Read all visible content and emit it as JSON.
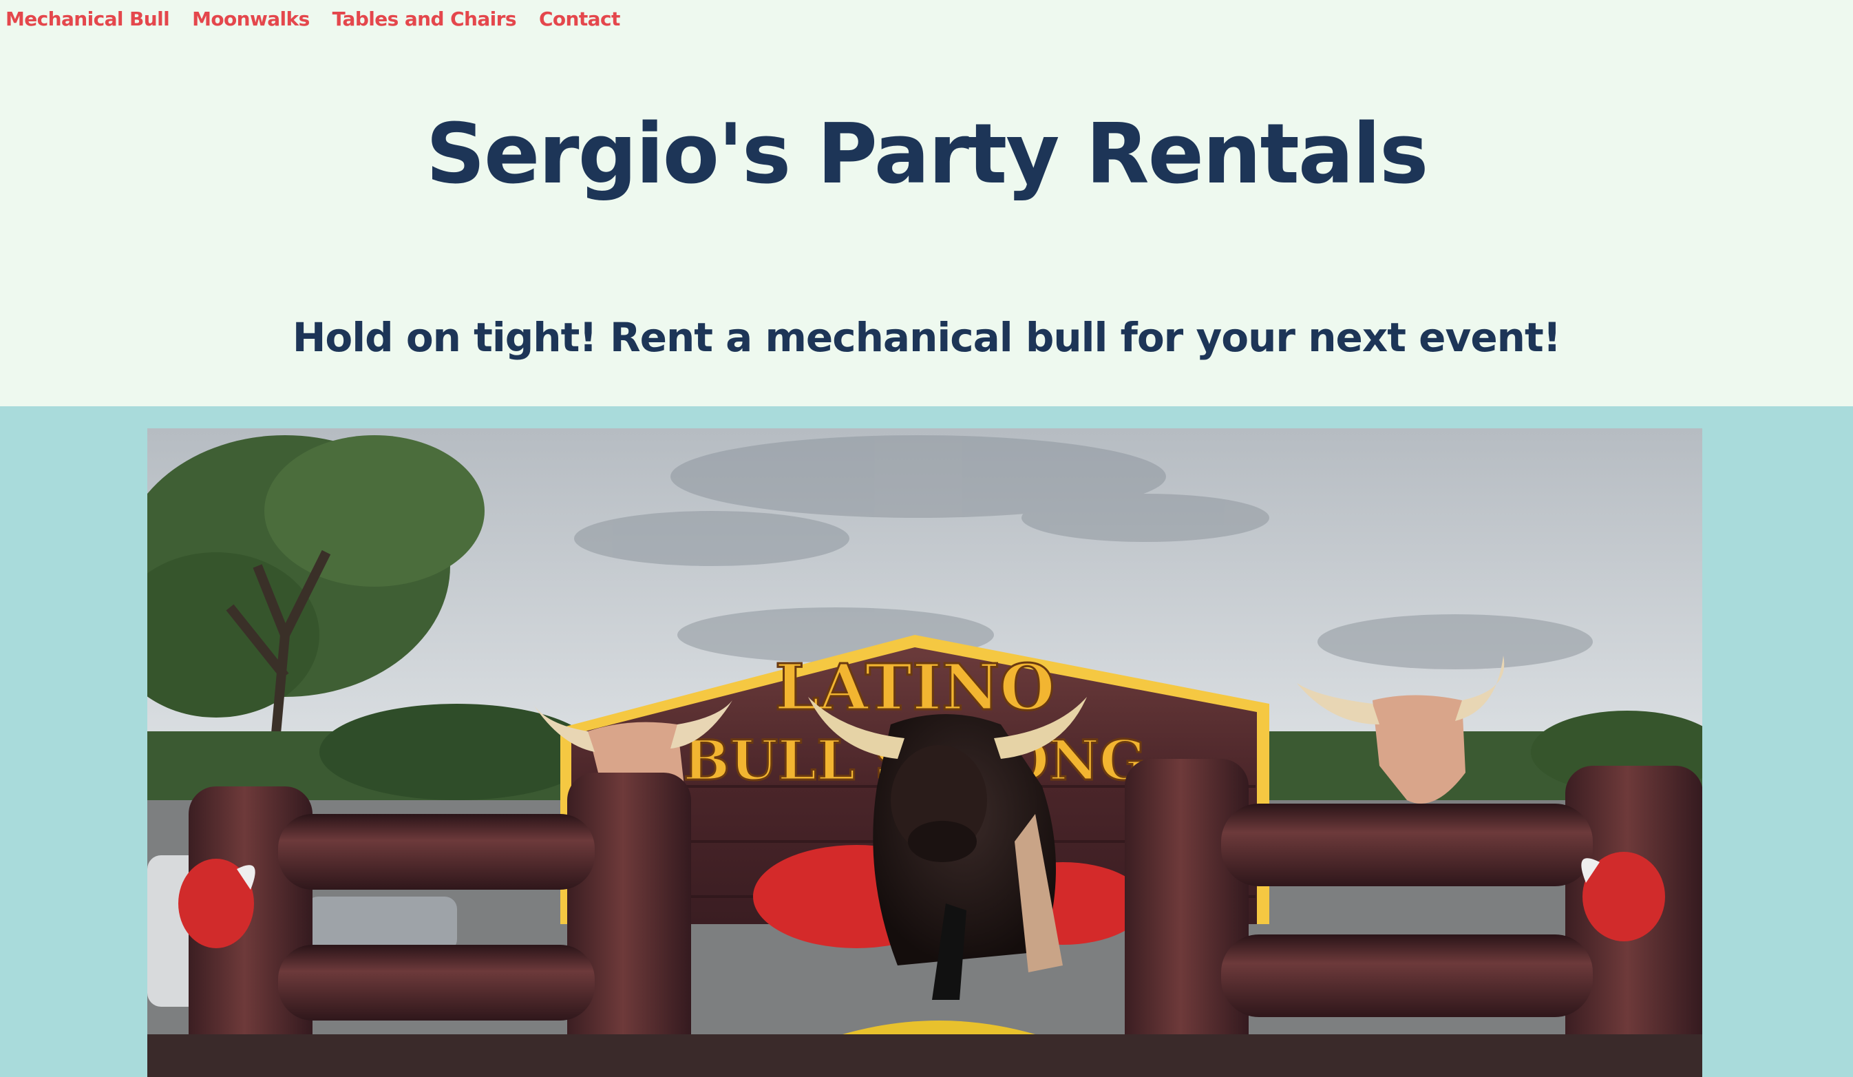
{
  "nav": {
    "items": [
      {
        "label": "Mechanical Bull"
      },
      {
        "label": "Moonwalks"
      },
      {
        "label": "Tables and Chairs"
      },
      {
        "label": "Contact"
      }
    ]
  },
  "header": {
    "title": "Sergio's Party Rentals"
  },
  "hero": {
    "tagline": "Hold on tight! Rent a mechanical bull for your next event!"
  },
  "photo": {
    "sign_lettering": "LATINO BULL STRONG"
  },
  "colors": {
    "nav_link": "#e4474c",
    "heading": "#1d3557",
    "header_bg": "#eef9ef",
    "band_bg": "#a9dbdb"
  }
}
